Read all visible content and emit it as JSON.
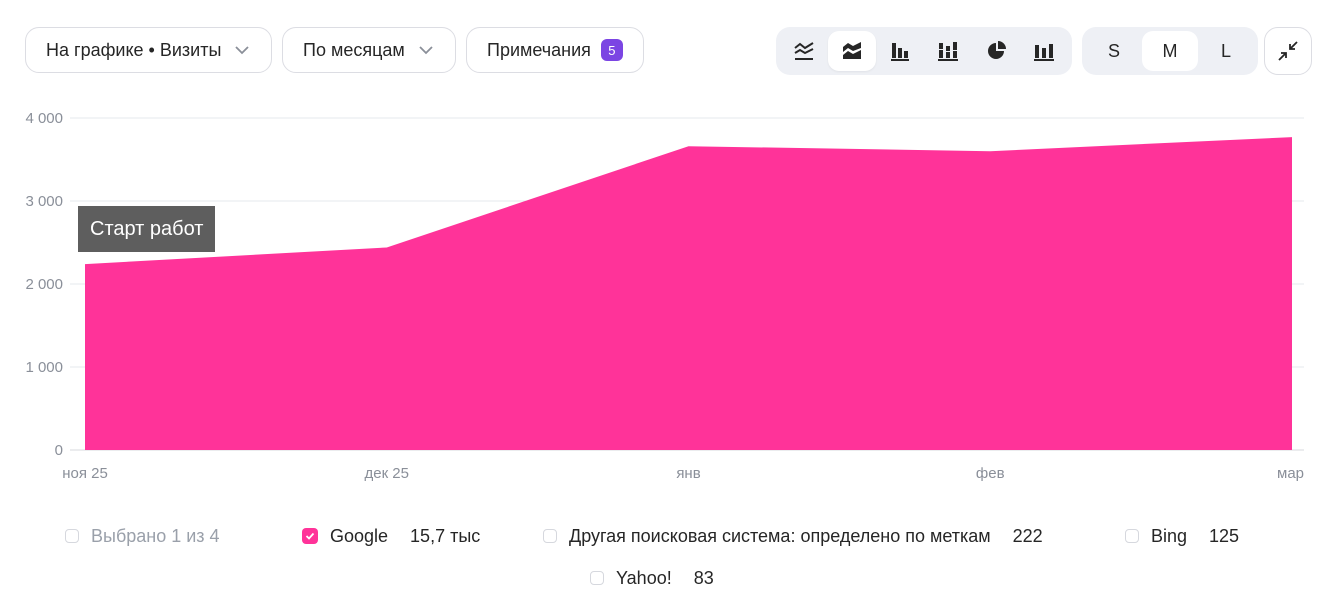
{
  "toolbar": {
    "metric_select": "На графике • Визиты",
    "group_select": "По месяцам",
    "notes_label": "Примечания",
    "notes_count": "5",
    "chart_types": [
      {
        "icon": "line-chart-icon",
        "active": false
      },
      {
        "icon": "stacked-area-chart-icon",
        "active": true
      },
      {
        "icon": "bar-chart-icon",
        "active": false
      },
      {
        "icon": "stacked-bar-chart-icon",
        "active": false
      },
      {
        "icon": "pie-chart-icon",
        "active": false
      },
      {
        "icon": "column-chart-icon",
        "active": false
      }
    ],
    "sizes": [
      {
        "label": "S",
        "active": false
      },
      {
        "label": "M",
        "active": true
      },
      {
        "label": "L",
        "active": false
      }
    ]
  },
  "colors": {
    "series": "#ff3399",
    "grid": "#e6e8ec",
    "tick": "#8a8f99",
    "accent": "#7b45e3"
  },
  "chart_data": {
    "type": "area",
    "categories": [
      "ноя 25",
      "дек 25",
      "янв",
      "фев",
      "мар"
    ],
    "series": [
      {
        "name": "Google",
        "values": [
          2240,
          2440,
          3660,
          3600,
          3770
        ]
      }
    ],
    "ylim": [
      0,
      4000
    ],
    "yticks": [
      0,
      1000,
      2000,
      3000,
      4000
    ],
    "ytick_labels": [
      "0",
      "1 000",
      "2 000",
      "3 000",
      "4 000"
    ],
    "grid": true,
    "annotation": {
      "category": "ноя 25",
      "text": "Старт работ"
    }
  },
  "legend": {
    "summary": "Выбрано 1 из 4",
    "items": [
      {
        "name": "Google",
        "value": "15,7 тыс",
        "checked": true
      },
      {
        "name": "Другая поисковая система: определено по меткам",
        "value": "222",
        "checked": false
      },
      {
        "name": "Bing",
        "value": "125",
        "checked": false
      },
      {
        "name": "Yahoo!",
        "value": "83",
        "checked": false
      }
    ]
  }
}
